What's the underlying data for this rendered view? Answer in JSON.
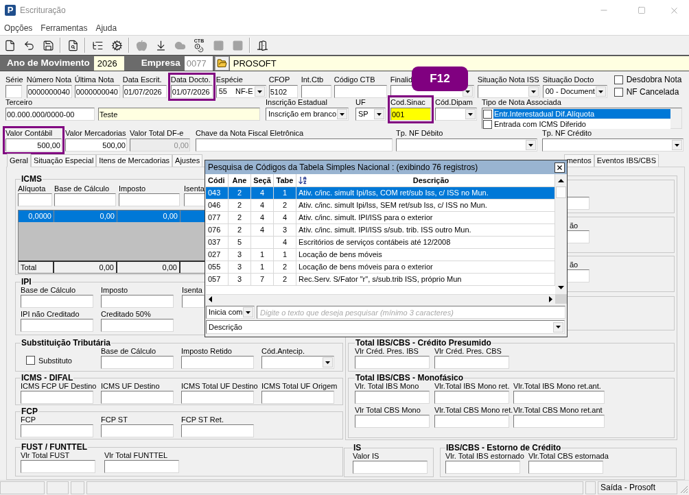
{
  "window": {
    "logo": "P",
    "title": "Escrituração"
  },
  "menu": [
    {
      "label": "Opções"
    },
    {
      "label": "Ferramentas"
    },
    {
      "label": "Ajuda"
    }
  ],
  "toolbar": [
    {
      "kind": "new",
      "disabled": false
    },
    {
      "kind": "undo",
      "disabled": false
    },
    {
      "kind": "save",
      "disabled": false
    },
    {
      "kind": "separator"
    },
    {
      "kind": "preview",
      "disabled": false
    },
    {
      "kind": "separator"
    },
    {
      "kind": "tree",
      "disabled": false
    },
    {
      "kind": "gears",
      "disabled": false
    },
    {
      "kind": "separator"
    },
    {
      "kind": "apple",
      "disabled": true
    },
    {
      "kind": "download",
      "disabled": false
    },
    {
      "kind": "cloud",
      "disabled": true
    },
    {
      "kind": "bag",
      "disabled": false,
      "caption": "CTB"
    },
    {
      "kind": "panel",
      "disabled": true
    },
    {
      "kind": "square",
      "disabled": true
    },
    {
      "kind": "separator"
    },
    {
      "kind": "exit",
      "disabled": false
    }
  ],
  "movement_bar": {
    "year_label": "Ano de Movimento",
    "year": {
      "value": "2026",
      "readonly": true
    },
    "company_label": "Empresa",
    "company_code": {
      "value": "0077",
      "disabled": true
    },
    "company_name": {
      "value": "PROSOFT",
      "readonly": true
    }
  },
  "header": {
    "row_1": [
      {
        "label": "Série",
        "kind": "text",
        "highlighted": false
      },
      {
        "label": "Número Nota",
        "kind": "text",
        "value": "0000000040",
        "highlighted": false
      },
      {
        "label": "Última Nota",
        "kind": "text",
        "value": "0000000040",
        "highlighted": false
      },
      {
        "label": "Data Escrit.",
        "kind": "text",
        "value": "01/07/2026",
        "highlighted": false
      },
      {
        "label": "Data Docto.",
        "kind": "text",
        "value": "01/07/2026",
        "highlighted": true
      },
      {
        "label": "Espécie",
        "kind": "combo",
        "value": "55",
        "detail": "NF-E",
        "highlighted": false
      },
      {
        "label": "CFOP",
        "kind": "text",
        "value": "5102",
        "highlighted": false
      },
      {
        "label": "Int.Ctb",
        "kind": "text",
        "highlighted": false
      },
      {
        "label": "Código CTB",
        "kind": "text",
        "highlighted": false
      },
      {
        "label": "Finalid",
        "kind": "combo",
        "highlighted": false
      },
      {
        "label": "Situação Nota ISS",
        "kind": "combo",
        "highlighted": false
      },
      {
        "label": "Situação Docto",
        "kind": "combo",
        "value": "00 - Document",
        "highlighted": false
      }
    ],
    "options": [
      {
        "label": "Desdobra Nota",
        "checked": false
      },
      {
        "label": "NF Cancelada",
        "checked": false
      }
    ],
    "row_2": [
      {
        "label": "Terceiro",
        "kind": "pair",
        "inputs": [
          {
            "value": "00.000.000/0000-00",
            "readonly": false
          },
          {
            "value": "Teste",
            "readonly": true
          }
        ],
        "focused": false,
        "highlighted": false
      },
      {
        "label": "Inscrição Estadual",
        "kind": "combo",
        "value": "Inscrição em branco",
        "focused": false,
        "highlighted": false
      },
      {
        "label": "UF",
        "kind": "combo",
        "value": "SP",
        "focused": false,
        "highlighted": false
      },
      {
        "label": "Cod.Sinac",
        "kind": "text",
        "value": "001",
        "focused": true,
        "highlighted": true
      },
      {
        "label": "Cód.Dipam",
        "kind": "combo",
        "focused": false,
        "highlighted": false
      },
      {
        "label": "Tipo de Nota Associada",
        "kind": "checklist",
        "focused": false,
        "highlighted": false,
        "items": [
          {
            "label": "Entr.Interestadual Dif.Alíquota",
            "checked": false,
            "selected": true
          },
          {
            "label": "Entrada com ICMS Diferido",
            "checked": false,
            "selected": false
          }
        ]
      }
    ],
    "row_3": [
      {
        "label": "Valor Contábil",
        "kind": "number",
        "value": "500,00",
        "disabled": false,
        "highlighted": true
      },
      {
        "label": "Valor Mercadorias",
        "kind": "number",
        "value": "500,00",
        "disabled": false,
        "highlighted": false
      },
      {
        "label": "Valor Total DF-e",
        "kind": "number",
        "value": "0,00",
        "disabled": true,
        "highlighted": false
      },
      {
        "label": "Chave da Nota Fiscal Eletrônica",
        "kind": "text",
        "disabled": false,
        "highlighted": false
      },
      {
        "label": "Tp. NF Débito",
        "kind": "combo",
        "disabled": false,
        "highlighted": false
      },
      {
        "label": "Tp. NF Crédito",
        "kind": "combo",
        "disabled": false,
        "highlighted": false
      }
    ]
  },
  "callout": {
    "text": "F12"
  },
  "tabs": [
    {
      "label": "Geral",
      "selected": true
    },
    {
      "label": "Situação Especial",
      "selected": false
    },
    {
      "label": "Itens de Mercadorias",
      "selected": false
    },
    {
      "label": "Ajustes",
      "selected": false
    },
    {
      "label": "mentos",
      "selected": false
    },
    {
      "label": "Eventos IBS/CBS",
      "selected": false
    }
  ],
  "icms": {
    "title": "ICMS",
    "fields": [
      {
        "label": "Alíquota",
        "kind": "text"
      },
      {
        "label": "Base de Cálculo",
        "kind": "text"
      },
      {
        "label": "Imposto",
        "kind": "text"
      },
      {
        "label": "Isenta",
        "kind": "text"
      }
    ],
    "grid": {
      "rows": [
        {
          "cells": [
            "0,0000",
            "0,00",
            "0,00"
          ],
          "selected": true
        }
      ],
      "total": {
        "label": "Total",
        "cells": [
          "0,00",
          "0,00"
        ]
      }
    }
  },
  "left_groups": [
    {
      "title": "IPI",
      "rows": [
        [
          {
            "label": "Base de Cálculo",
            "kind": "text"
          },
          {
            "label": "Imposto",
            "kind": "text"
          },
          {
            "label": "Isenta",
            "kind": "text"
          }
        ],
        [
          {
            "label": "IPI não Creditado",
            "kind": "text"
          },
          {
            "label": "Creditado 50%",
            "kind": "text"
          }
        ]
      ]
    },
    {
      "title": "Substituição Tributária",
      "option": {
        "label": "Substituto",
        "checked": false
      },
      "rows": [
        [
          {
            "label": "Base de Cálculo",
            "kind": "text"
          },
          {
            "label": "Imposto Retido",
            "kind": "text"
          },
          {
            "label": "Cód.Antecip.",
            "kind": "combo"
          }
        ]
      ]
    },
    {
      "title": "ICMS - DIFAL",
      "rows": [
        [
          {
            "label": "ICMS FCP UF Destino",
            "kind": "text"
          },
          {
            "label": "ICMS UF Destino",
            "kind": "text"
          },
          {
            "label": "ICMS Total UF Destino",
            "kind": "text"
          },
          {
            "label": "ICMS Total UF Origem",
            "kind": "text"
          }
        ]
      ]
    },
    {
      "title": "FCP",
      "rows": [
        [
          {
            "label": "FCP",
            "kind": "text"
          },
          {
            "label": "FCP ST",
            "kind": "text"
          },
          {
            "label": "FCP ST Ret.",
            "kind": "text"
          }
        ]
      ]
    },
    {
      "title": "FUST / FUNTTEL",
      "rows": [
        [
          {
            "label": "Vlr Total FUST",
            "kind": "text"
          },
          {
            "label": "Vlr Total FUNTTEL",
            "kind": "text"
          }
        ]
      ]
    }
  ],
  "covered_groups": [
    {
      "kind": "input"
    },
    {
      "kind": "labeled",
      "label": "ão"
    },
    {
      "kind": "labeled",
      "label": "ão"
    },
    {
      "kind": "blank"
    }
  ],
  "right_groups": [
    {
      "title": "Total IBS/CBS - Crédito Presumido",
      "rows": [
        [
          {
            "label": "Vlr Créd. Pres. IBS",
            "kind": "text"
          },
          {
            "label": "Vlr Créd. Pres. CBS",
            "kind": "text"
          }
        ]
      ]
    },
    {
      "title": "Total IBS/CBS - Monofásico",
      "rows": [
        [
          {
            "label": "Vlr. Total IBS Mono",
            "kind": "text"
          },
          {
            "label": "Vlr.Total IBS Mono ret.",
            "kind": "text"
          },
          {
            "label": "Vlr.Total IBS Mono ret.ant.",
            "kind": "text"
          }
        ],
        [
          {
            "label": "Vlr Total CBS Mono",
            "kind": "text"
          },
          {
            "label": "Vlr.Total CBS Mono ret.",
            "kind": "text"
          },
          {
            "label": "Vlr.Total CBS Mono ret.ant",
            "kind": "text"
          }
        ]
      ]
    }
  ],
  "bottom_groups": [
    {
      "title": "IS",
      "rows": [
        [
          {
            "label": "Valor IS",
            "kind": "text"
          }
        ]
      ]
    },
    {
      "title": "IBS/CBS - Estorno de Crédito",
      "rows": [
        [
          {
            "label": "Vlr. Total IBS estornado",
            "kind": "text"
          },
          {
            "label": "Vlr.Total CBS estornada",
            "kind": "text"
          }
        ]
      ]
    }
  ],
  "search_dialog": {
    "title": "Pesquisa de Códigos da Tabela Simples Nacional : (exibindo 76 registros)",
    "columns": [
      {
        "label": "Códi",
        "sorted": false
      },
      {
        "label": "Ane",
        "sorted": false
      },
      {
        "label": "Seçã",
        "sorted": false
      },
      {
        "label": "Tabe",
        "sorted": false
      },
      {
        "label": "Descrição",
        "sorted": true
      }
    ],
    "rows": [
      {
        "col_1": "043",
        "col_2": "2",
        "col_3": "4",
        "col_4": "1",
        "col_5": "Ativ. c/inc. simult Ipi/Iss, COM ret/sub Iss, c/ ISS no Mun.",
        "selected": true
      },
      {
        "col_1": "046",
        "col_2": "2",
        "col_3": "4",
        "col_4": "2",
        "col_5": "Ativ. c/inc. simult Ipi/Iss, SEM ret/sub Iss, c/ ISS no Mun.",
        "selected": false
      },
      {
        "col_1": "077",
        "col_2": "2",
        "col_3": "4",
        "col_4": "4",
        "col_5": "Ativ. c/inc. simult. IPI/ISS para o exterior",
        "selected": false
      },
      {
        "col_1": "076",
        "col_2": "2",
        "col_3": "4",
        "col_4": "3",
        "col_5": "Ativ. c/inc. simult. IPI/ISS s/sub. trib. ISS outro Mun.",
        "selected": false
      },
      {
        "col_1": "037",
        "col_2": "5",
        "col_4": "4",
        "col_5": "Escritórios de serviços contábeis até 12/2008",
        "selected": false
      },
      {
        "col_1": "027",
        "col_2": "3",
        "col_3": "1",
        "col_4": "1",
        "col_5": "Locação de bens móveis",
        "selected": false
      },
      {
        "col_1": "055",
        "col_2": "3",
        "col_3": "1",
        "col_4": "2",
        "col_5": "Locação de bens móveis para o exterior",
        "selected": false
      },
      {
        "col_1": "057",
        "col_2": "3",
        "col_3": "7",
        "col_4": "2",
        "col_5": "Rec.Serv. S/Fator \"r\", s/sub.trib ISS, próprio Mun",
        "selected": false
      }
    ],
    "match_mode": "Inicia com",
    "search": {
      "placeholder": "Digite o texto que deseja pesquisar (mínimo 3 caracteres)"
    },
    "search_column": "Descrição"
  },
  "status_bar": {
    "text": "Saída - Prosoft"
  }
}
